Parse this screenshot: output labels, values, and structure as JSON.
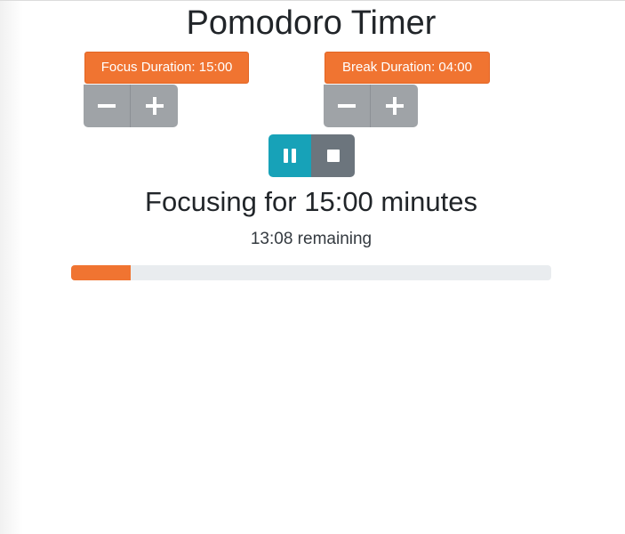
{
  "title": "Pomodoro Timer",
  "focus": {
    "badge_label": "Focus Duration: 15:00",
    "decrement_icon": "minus-icon",
    "increment_icon": "plus-icon"
  },
  "break": {
    "badge_label": "Break Duration: 04:00",
    "decrement_icon": "minus-icon",
    "increment_icon": "plus-icon"
  },
  "controls": {
    "pause_icon": "pause-icon",
    "stop_icon": "stop-icon"
  },
  "status": {
    "message": "Focusing for 15:00 minutes",
    "remaining": "13:08 remaining"
  },
  "progress": {
    "fraction": 0.124
  },
  "colors": {
    "accent": "#f07431",
    "stepper": "#9fa3a7",
    "pause": "#17a2b8",
    "stop": "#6c757d",
    "track": "#e9ecef"
  }
}
